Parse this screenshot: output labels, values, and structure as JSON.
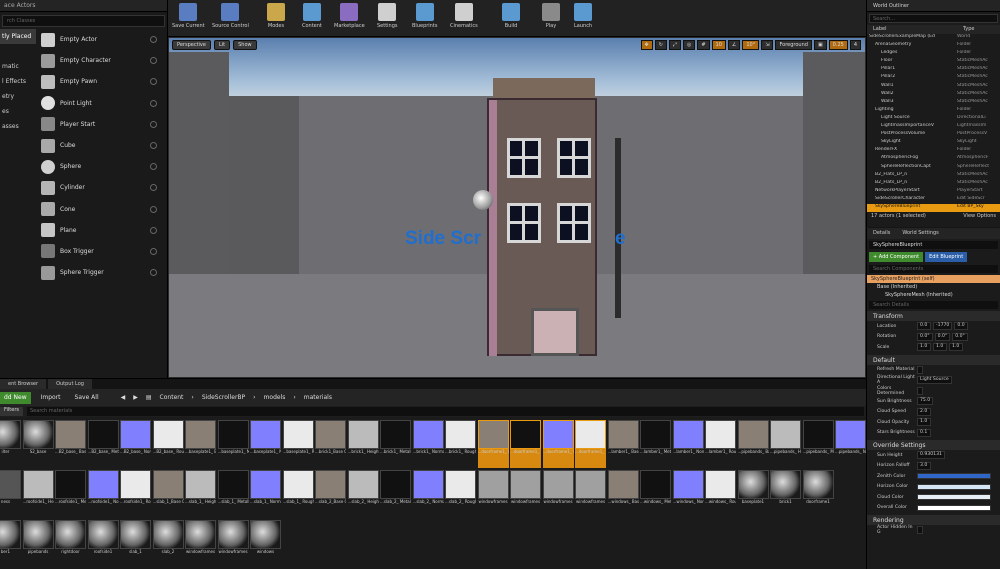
{
  "place": {
    "tab_title": "ace Actors",
    "search_placeholder": "rch Classes",
    "categories": [
      "tly Placed",
      "",
      "matic",
      "l Effects",
      "etry",
      "es",
      "asses"
    ],
    "items": [
      "Empty Actor",
      "Empty Character",
      "Empty Pawn",
      "Point Light",
      "Player Start",
      "Cube",
      "Sphere",
      "Cylinder",
      "Cone",
      "Plane",
      "Box Trigger",
      "Sphere Trigger"
    ]
  },
  "toolbar": {
    "buttons": [
      "Save Current",
      "Source Control",
      "Modes",
      "Content",
      "Marketplace",
      "Settings",
      "Blueprints",
      "Cinematics",
      "Build",
      "Play",
      "Launch"
    ]
  },
  "viewport": {
    "perspective": "Perspective",
    "lit": "Lit",
    "show": "Show",
    "snap_values": [
      "10",
      "10°",
      "Foreground",
      "0.25",
      "4"
    ],
    "text_left": "Side Scr",
    "text_right": "e"
  },
  "content_browser": {
    "tabs": [
      "ent Browser",
      "Output Log"
    ],
    "add_new": "dd New",
    "import": "Import",
    "save_all": "Save All",
    "breadcrumb": [
      "Content",
      "SideScrollerBP",
      "models",
      "materials"
    ],
    "filters": "Filters",
    "search_placeholder": "Search materials",
    "row1": [
      "ilter",
      "S2_base",
      "...B2_base_ BaseColor",
      "...B2_base_ Metallic",
      "...B2_base_ Normal",
      "...B2_base_ Roughness",
      "...baseplate1_ BaseColor",
      "...baseplate1_ Metallic",
      "...baseplate1_ Normal",
      "...baseplate1_ Roughness",
      "...brick1_Base Color",
      "...brick1_ Height",
      "...brick1_ Metallic",
      "...brick1_ Normal",
      "...brick1_ Roughness",
      "...doorframe1_ BaseColor",
      "...doorframe1_ Metallic",
      "...doorframe1_ Normal",
      "...doorframe1_ Roughness",
      "...lamber1_ BaseColor",
      "...lamber1_ Metallic",
      "...lamber1_ Normal",
      "...lamber1_ Roughness",
      "...pipebands_ BaseColor",
      "...pipebands_ Height",
      "...pipebands_ Metallic",
      "...pipebands_ Normal"
    ],
    "row2": [
      "ness",
      "...roofside1_ Height",
      "...roofside1_ Metallic",
      "...roofside1_ Normal",
      "...roofside1_ Roughness",
      "...slab_1_Base Color",
      "...slab_1_ Height",
      "...slab_1_ Metallic",
      "...slab_1_ Normal",
      "...slab_1_ Roughness",
      "...slab_2_Base Color",
      "...slab_2_ Height",
      "...slab_2_ Metallic",
      "...slab_2_ Normal",
      "...slab_2_ Roughness",
      "windowframes",
      "windowframes",
      "windowframes",
      "windowframes",
      "...windows_ BaseColor",
      "...windows_ Metallic",
      "...windows_ Normal",
      "...windows_ Roughness",
      "baseplate1",
      "brick1",
      "doorframe1"
    ],
    "row3": [
      "ber1",
      "pipebands",
      "rightdoor",
      "roofside1",
      "slab_1",
      "slab_2",
      "windowframes",
      "windowframes",
      "windows"
    ]
  },
  "outliner": {
    "tab": "World Outliner",
    "search_placeholder": "Search...",
    "col_label": "Label",
    "col_type": "Type",
    "rows": [
      {
        "n": "SideScrollerExampleMap (Ed",
        "t": "World"
      },
      {
        "n": "ArenaGeometry",
        "t": "Folder"
      },
      {
        "n": "Ledges",
        "t": "Folder"
      },
      {
        "n": "Floor",
        "t": "StaticMeshAc"
      },
      {
        "n": "Pillar1",
        "t": "StaticMeshAc"
      },
      {
        "n": "Pillar2",
        "t": "StaticMeshAc"
      },
      {
        "n": "Wall1",
        "t": "StaticMeshAc"
      },
      {
        "n": "Wall2",
        "t": "StaticMeshAc"
      },
      {
        "n": "Wall3",
        "t": "StaticMeshAc"
      },
      {
        "n": "Lighting",
        "t": "Folder"
      },
      {
        "n": "Light Source",
        "t": "DirectionalLi"
      },
      {
        "n": "LightmassImportanceV",
        "t": "LightmassIm"
      },
      {
        "n": "PostProcessVolume",
        "t": "PostProcessV"
      },
      {
        "n": "SkyLight",
        "t": "SkyLight"
      },
      {
        "n": "RenderFX",
        "t": "Folder"
      },
      {
        "n": "AtmosphericFog",
        "t": "AtmosphericF"
      },
      {
        "n": "SphereReflectionCapt",
        "t": "SphereReflect"
      },
      {
        "n": "B2_Flats_LP_n",
        "t": "StaticMeshAc"
      },
      {
        "n": "B2_Flats_LP_n",
        "t": "StaticMeshAc"
      },
      {
        "n": "NetworkPlayerStart",
        "t": "PlayerStart"
      },
      {
        "n": "SideScrollerCharacter",
        "t": "Edit SideScr"
      },
      {
        "n": "SkySphereBlueprint",
        "t": "Edit BP_Sky"
      }
    ],
    "footer": "17 actors (1 selected)",
    "view_options": "View Options"
  },
  "details": {
    "tabs": [
      "Details",
      "World Settings"
    ],
    "actor_name": "SkySphereBlueprint",
    "add_component": "+ Add Component",
    "edit_blueprint": "Edit Blueprint",
    "search_components": "Search Components",
    "self": "SkySphereBlueprint (self)",
    "base": "Base (Inherited)",
    "mesh": "SkySphereMesh (Inherited)",
    "search_details": "Search Details",
    "transform": "Transform",
    "location_label": "Location",
    "location": [
      "0.0",
      "-1770",
      "0.0"
    ],
    "rotation_label": "Rotation",
    "rotation": [
      "0.0°",
      "0.0°",
      "0.0°"
    ],
    "scale_label": "Scale",
    "scale": [
      "1.0",
      "1.0",
      "1.0"
    ],
    "default": "Default",
    "props": [
      {
        "l": "Refresh Material",
        "v": ""
      },
      {
        "l": "Directional Light A",
        "v": "Light Source"
      },
      {
        "l": "Colors Determined",
        "v": ""
      },
      {
        "l": "Sun Brightness",
        "v": "75.0"
      },
      {
        "l": "Cloud Speed",
        "v": "2.0"
      },
      {
        "l": "Cloud Opacity",
        "v": "1.0"
      },
      {
        "l": "Stars Brightness",
        "v": "0.1"
      }
    ],
    "override": "Override Settings",
    "override_props": [
      {
        "l": "Sun Height",
        "v": "0.930131"
      },
      {
        "l": "Horizon Falloff",
        "v": "3.0"
      }
    ],
    "colors": [
      {
        "l": "Zenith Color",
        "c": "#2f66c8"
      },
      {
        "l": "Horizon Color",
        "c": "#d4e6f6"
      },
      {
        "l": "Cloud Color",
        "c": "#e8eef6"
      },
      {
        "l": "Overall Color",
        "c": "#ffffff"
      }
    ],
    "rendering": "Rendering",
    "actor_hidden": "Actor Hidden In G"
  }
}
